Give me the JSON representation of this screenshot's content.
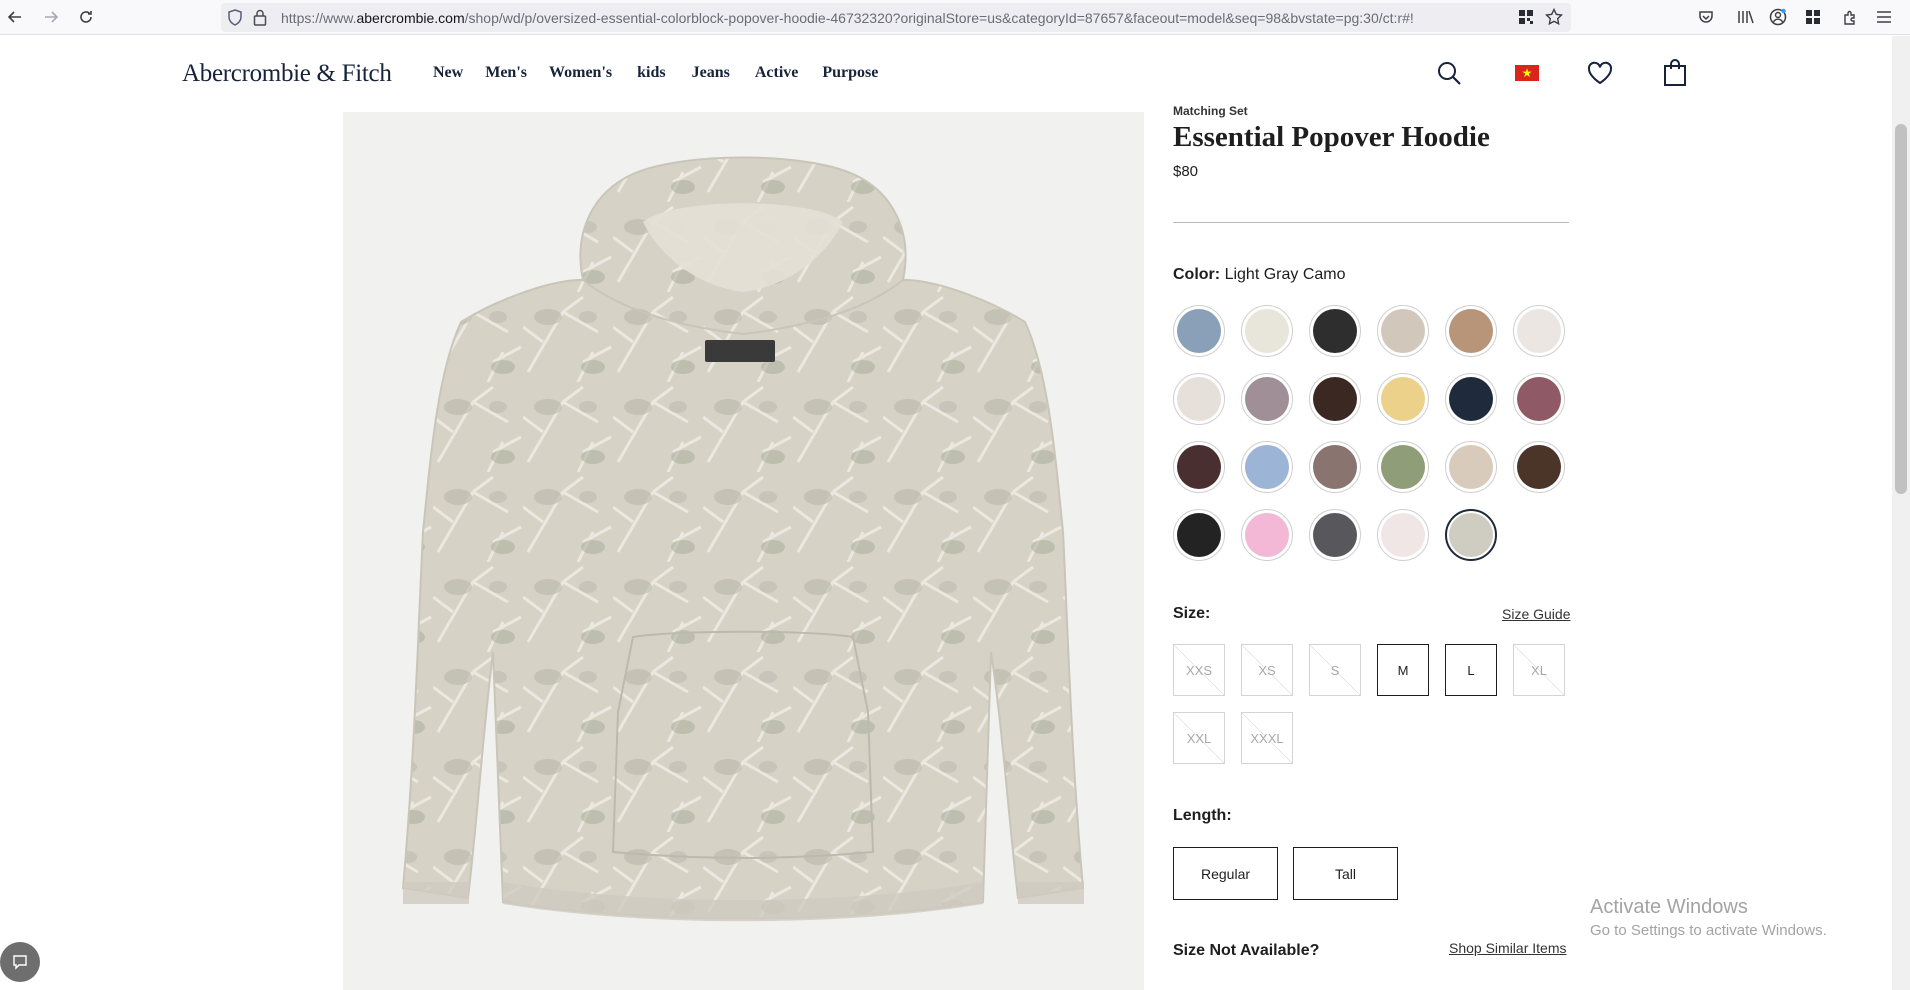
{
  "browser": {
    "url_prefix": "https://www.",
    "url_domain": "abercrombie.com",
    "url_rest": "/shop/wd/p/oversized-essential-colorblock-popover-hoodie-46732320?originalStore=us&categoryId=87657&faceout=model&seq=98&bvstate=pg:30/ct:r#!"
  },
  "header": {
    "logo": "Abercrombie & Fitch",
    "nav": [
      "New",
      "Men's",
      "Women's",
      "kids",
      "Jeans",
      "Active",
      "Purpose"
    ],
    "flag_color": "#da251d"
  },
  "product": {
    "eyebrow": "Matching Set",
    "title": "Essential Popover Hoodie",
    "price": "$80",
    "color_label": "Color:",
    "color_value": "Light Gray Camo",
    "swatches": [
      {
        "name": "multicolor-plaid-pattern",
        "color": "#8aa0b8"
      },
      {
        "name": "cream",
        "color": "#e8e6da"
      },
      {
        "name": "black",
        "color": "#2e2e2e"
      },
      {
        "name": "oatmeal",
        "color": "#d2c7bb"
      },
      {
        "name": "floral-print",
        "color": "#b89478"
      },
      {
        "name": "line-art-print",
        "color": "#ece6e2"
      },
      {
        "name": "light-cream",
        "color": "#e6e0da"
      },
      {
        "name": "mauve-gray",
        "color": "#a08f96"
      },
      {
        "name": "dark-brown",
        "color": "#3b2822"
      },
      {
        "name": "butter-yellow",
        "color": "#ecd18a"
      },
      {
        "name": "navy",
        "color": "#1f2a3c"
      },
      {
        "name": "rose-brown",
        "color": "#8f5a66"
      },
      {
        "name": "plum-brown",
        "color": "#4a2f30"
      },
      {
        "name": "light-blue",
        "color": "#9cb4d6"
      },
      {
        "name": "taupe",
        "color": "#8a7470"
      },
      {
        "name": "sage",
        "color": "#8f9e78"
      },
      {
        "name": "sand",
        "color": "#d8cbbb"
      },
      {
        "name": "chocolate",
        "color": "#4b3428"
      },
      {
        "name": "black-2",
        "color": "#232323"
      },
      {
        "name": "pink",
        "color": "#f2b8d6"
      },
      {
        "name": "charcoal",
        "color": "#58585c"
      },
      {
        "name": "blush",
        "color": "#f1e6e6"
      },
      {
        "name": "light-gray-camo",
        "color": "#cfccc2"
      }
    ],
    "selected_swatch": "light-gray-camo",
    "size_label": "Size:",
    "size_guide": "Size Guide",
    "sizes": [
      {
        "label": "XXS",
        "available": false
      },
      {
        "label": "XS",
        "available": false
      },
      {
        "label": "S",
        "available": false
      },
      {
        "label": "M",
        "available": true
      },
      {
        "label": "L",
        "available": true
      },
      {
        "label": "XL",
        "available": false
      },
      {
        "label": "XXL",
        "available": false
      },
      {
        "label": "XXXL",
        "available": false
      }
    ],
    "length_label": "Length:",
    "lengths": [
      "Regular",
      "Tall"
    ],
    "size_na_label": "Size Not Available?",
    "shop_similar": "Shop Similar Items"
  },
  "os_watermark": {
    "line1": "Activate Windows",
    "line2": "Go to Settings to activate Windows."
  }
}
